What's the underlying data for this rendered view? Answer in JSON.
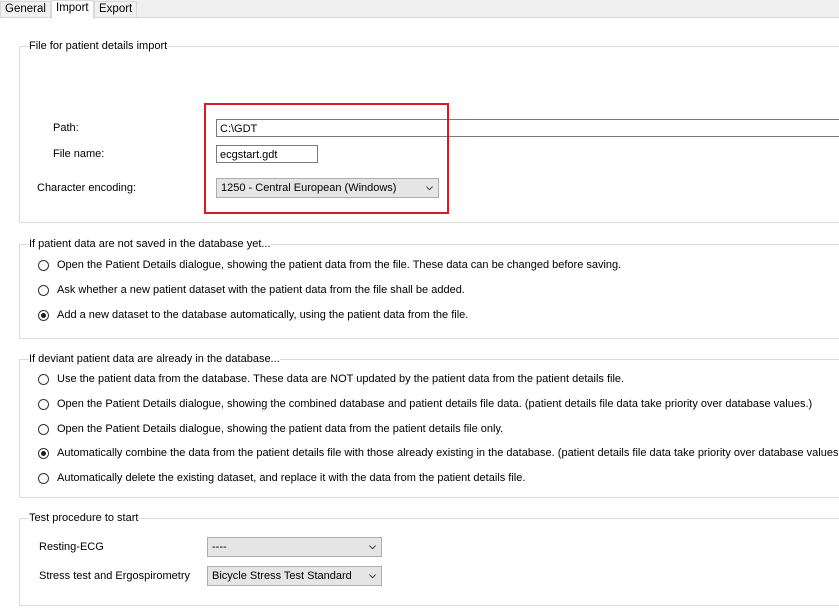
{
  "tabs": [
    {
      "label": "General",
      "active": false
    },
    {
      "label": "Import",
      "active": true
    },
    {
      "label": "Export",
      "active": false
    }
  ],
  "file_group": {
    "title": "File for patient details import",
    "path_label": "Path:",
    "path_value": "C:\\GDT",
    "filename_label": "File name:",
    "filename_value": "ecgstart.gdt",
    "encoding_label": "Character encoding:",
    "encoding_value": "1250 - Central European (Windows)"
  },
  "not_saved_group": {
    "title": "If patient data are not saved in the database yet...",
    "options": [
      {
        "label": "Open the Patient Details dialogue, showing the patient data from the file. These data can be changed before saving.",
        "checked": false
      },
      {
        "label": "Ask whether a new patient dataset with the patient data from the file shall be added.",
        "checked": false
      },
      {
        "label": "Add a new dataset to the database automatically, using the patient data from the file.",
        "checked": true
      }
    ]
  },
  "deviant_group": {
    "title": "If deviant patient data are already in the database...",
    "options": [
      {
        "label": "Use the patient data from the database. These data are NOT updated by the patient data from the patient details file.",
        "checked": false
      },
      {
        "label": "Open the Patient Details dialogue, showing the combined database and patient details file data. (patient details file data take priority over database values.)",
        "checked": false
      },
      {
        "label": "Open the Patient Details dialogue, showing the patient data from the patient details file only.",
        "checked": false
      },
      {
        "label": "Automatically combine the data from the patient details file with those already existing in the database. (patient details file data take priority over database values.)",
        "checked": true
      },
      {
        "label": "Automatically delete the existing dataset, and replace it with the data from the patient details file.",
        "checked": false
      }
    ]
  },
  "test_group": {
    "title": "Test procedure to start",
    "resting_label": "Resting-ECG",
    "resting_value": "----",
    "stress_label": "Stress test and Ergospirometry",
    "stress_value": "Bicycle Stress Test Standard"
  },
  "colors": {
    "highlight": "#d71a28"
  },
  "icons": {
    "combo_arrow": "chevron-down-icon"
  }
}
